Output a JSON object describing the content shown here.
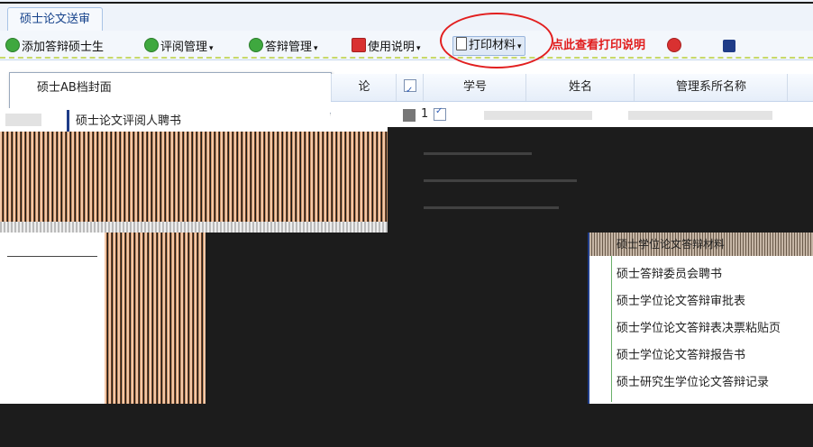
{
  "tab": {
    "title": "硕士论文送审"
  },
  "toolbar": {
    "add_label": "添加答辩硕士生",
    "review_label": "评阅管理",
    "defense_label": "答辩管理",
    "usage_label": "使用说明",
    "print_label": "打印材料",
    "print_hint": "点此查看打印说明",
    "dropdown_glyph": "▾"
  },
  "menu_upper": {
    "items": [
      "硕士AB档封面",
      "硕士论文评阅人聘书"
    ]
  },
  "grid": {
    "headers": [
      "论",
      "学号",
      "姓名",
      "管理系所名称"
    ],
    "row": {
      "number": "1"
    }
  },
  "menu_lower": {
    "header": "硕士学位论文答辩材料",
    "items": [
      "硕士答辩委员会聘书",
      "硕士学位论文答辩审批表",
      "硕士学位论文答辩表决票粘贴页",
      "硕士学位论文答辩报告书",
      "硕士研究生学位论文答辩记录"
    ]
  },
  "colors": {
    "accent": "#15428b",
    "highlight": "#e21f1f",
    "menu_border": "#1f3c88"
  },
  "icons": [
    "add-icon",
    "review-icon",
    "defense-icon",
    "pdf-icon",
    "print-icon"
  ]
}
